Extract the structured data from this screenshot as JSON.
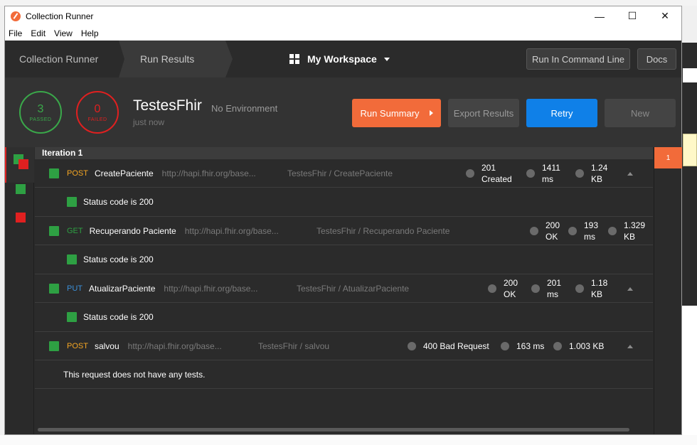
{
  "window": {
    "title": "Collection Runner",
    "minimize": "—",
    "maximize": "☐",
    "close": "✕"
  },
  "menu": [
    "File",
    "Edit",
    "View",
    "Help"
  ],
  "nav": {
    "crumb_collection_runner": "Collection Runner",
    "crumb_run_results": "Run Results",
    "workspace": "My Workspace",
    "run_in_command_line": "Run In Command Line",
    "docs": "Docs"
  },
  "summary": {
    "passed_count": "3",
    "passed_label": "PASSED",
    "failed_count": "0",
    "failed_label": "FAILED",
    "collection_name": "TestesFhir",
    "environment": "No Environment",
    "time": "just now",
    "run_summary": "Run Summary",
    "export_results": "Export Results",
    "retry": "Retry",
    "new": "New"
  },
  "iteration": {
    "label": "Iteration 1",
    "badge": "1"
  },
  "requests": [
    {
      "method": "POST",
      "name": "CreatePaciente",
      "url": "http://hapi.fhir.org/base...",
      "path": "TestesFhir / CreatePaciente",
      "status_l1": "201",
      "status_l2": "Created",
      "time_l1": "1411",
      "time_l2": "ms",
      "size_l1": "1.24",
      "size_l2": "KB",
      "test": "Status code is 200"
    },
    {
      "method": "GET",
      "name": "Recuperando Paciente",
      "url": "http://hapi.fhir.org/base...",
      "path": "TestesFhir / Recuperando Paciente",
      "status_l1": "200",
      "status_l2": "OK",
      "time_l1": "193",
      "time_l2": "ms",
      "size_l1": "1.329",
      "size_l2": "KB",
      "test": "Status code is 200"
    },
    {
      "method": "PUT",
      "name": "AtualizarPaciente",
      "url": "http://hapi.fhir.org/base...",
      "path": "TestesFhir / AtualizarPaciente",
      "status_l1": "200",
      "status_l2": "OK",
      "time_l1": "201",
      "time_l2": "ms",
      "size_l1": "1.18",
      "size_l2": "KB",
      "test": "Status code is 200"
    },
    {
      "method": "POST",
      "name": "salvou",
      "url": "http://hapi.fhir.org/base...",
      "path": "TestesFhir / salvou",
      "status": "400 Bad Request",
      "time": "163 ms",
      "size": "1.003 KB",
      "no_tests": "This request does not have any tests."
    }
  ],
  "colors": {
    "pass": "#2ea043",
    "fail": "#e02020",
    "accent": "#f26b3a",
    "retry": "#0f80e8"
  }
}
